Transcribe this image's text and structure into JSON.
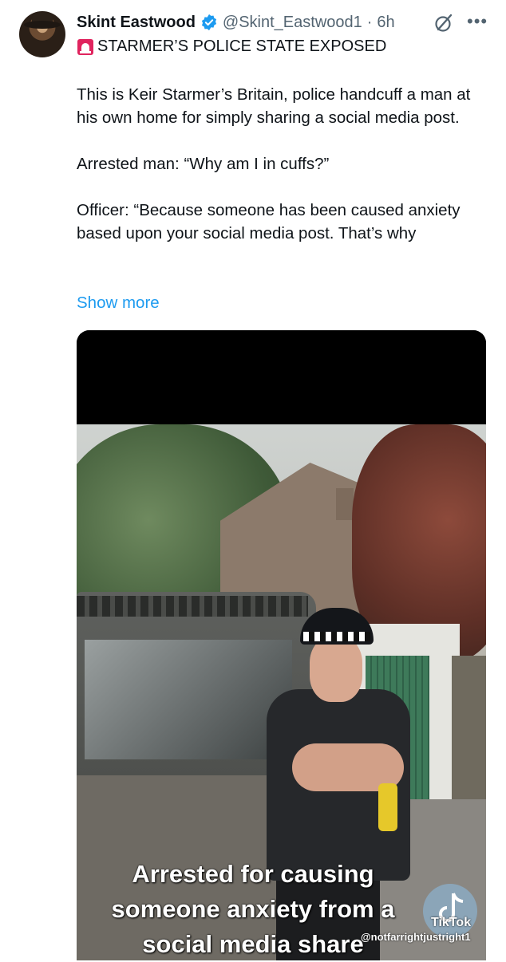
{
  "tweet": {
    "author_name": "Skint Eastwood",
    "handle": "@Skint_Eastwood1",
    "dot": "·",
    "time": "6h",
    "headline": "STARMER’S POLICE STATE EXPOSED",
    "paragraphs": [
      "This is Keir Starmer’s Britain, police handcuff a man at his own home for simply sharing a social media post.",
      "Arrested man: “Why am I in cuffs?”",
      "Officer: “Because someone has been caused anxiety based upon your social media post. That’s why"
    ],
    "show_more": "Show more"
  },
  "media": {
    "caption_lines": [
      "Arrested for causing",
      "someone anxiety from a",
      "social media share"
    ],
    "watermark_brand": "TikTok",
    "watermark_handle": "@notfarrightjustright1"
  },
  "colors": {
    "link": "#1d9bf0",
    "verified": "#1d9bf0",
    "siren": "#e0245e",
    "secondary_text": "#536471"
  },
  "icons": {
    "verified": "verified-badge-icon",
    "grok": "grok-icon",
    "more": "more-options-icon",
    "siren": "siren-icon",
    "tiktok": "tiktok-logo-icon"
  }
}
